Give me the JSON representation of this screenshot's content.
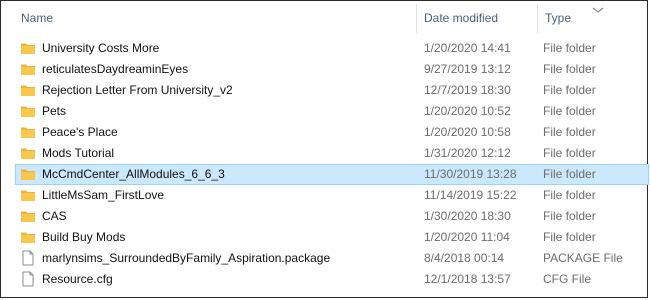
{
  "columns": {
    "name": "Name",
    "date_modified": "Date modified",
    "type": "Type"
  },
  "files": [
    {
      "name": "University Costs More",
      "date": "1/20/2020 14:41",
      "type": "File folder",
      "icon": "folder-icon"
    },
    {
      "name": "reticulatesDaydreaminEyes",
      "date": "9/27/2019 13:12",
      "type": "File folder",
      "icon": "folder-icon"
    },
    {
      "name": "Rejection Letter From University_v2",
      "date": "12/7/2019 18:30",
      "type": "File folder",
      "icon": "folder-icon"
    },
    {
      "name": "Pets",
      "date": "1/20/2020 10:52",
      "type": "File folder",
      "icon": "folder-icon"
    },
    {
      "name": "Peace's Place",
      "date": "1/20/2020 10:58",
      "type": "File folder",
      "icon": "folder-icon"
    },
    {
      "name": "Mods Tutorial",
      "date": "1/31/2020 12:12",
      "type": "File folder",
      "icon": "folder-icon"
    },
    {
      "name": "McCmdCenter_AllModules_6_6_3",
      "date": "11/30/2019 13:28",
      "type": "File folder",
      "icon": "folder-icon",
      "selected": true
    },
    {
      "name": "LittleMsSam_FirstLove",
      "date": "11/14/2019 15:22",
      "type": "File folder",
      "icon": "folder-icon"
    },
    {
      "name": "CAS",
      "date": "1/30/2020 18:30",
      "type": "File folder",
      "icon": "folder-icon"
    },
    {
      "name": "Build Buy Mods",
      "date": "1/20/2020 11:04",
      "type": "File folder",
      "icon": "folder-icon"
    },
    {
      "name": "marlynsims_SurroundedByFamily_Aspiration.package",
      "date": "8/4/2018 00:14",
      "type": "PACKAGE File",
      "icon": "file-icon"
    },
    {
      "name": "Resource.cfg",
      "date": "12/1/2018 13:57",
      "type": "CFG File",
      "icon": "file-icon"
    }
  ],
  "colors": {
    "header_text": "#4c607a",
    "selection_bg": "#cce8ff",
    "selection_border": "#99d1ff",
    "folder": "#f8c74d"
  }
}
